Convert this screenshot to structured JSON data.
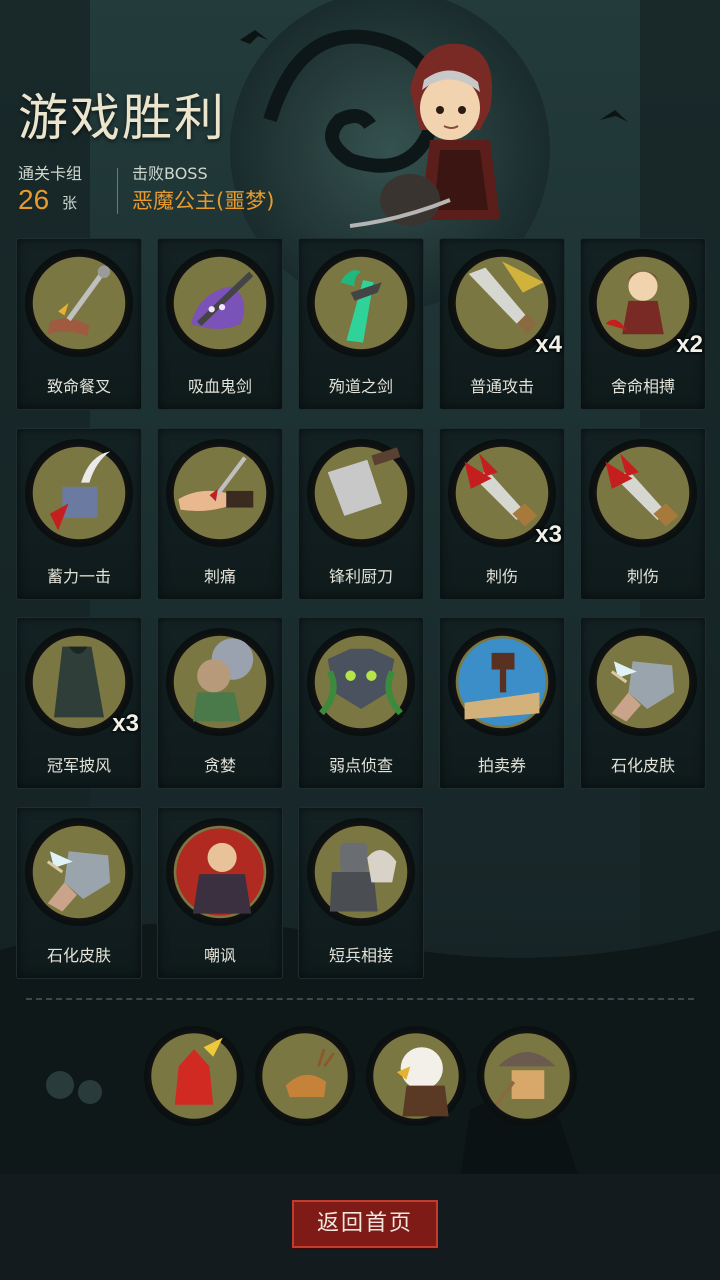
{
  "header": {
    "title": "游戏胜利",
    "deck_label": "通关卡组",
    "deck_count": "26",
    "deck_unit": "张",
    "boss_label": "击败BOSS",
    "boss_name": "恶魔公主(噩梦)"
  },
  "cards": [
    {
      "name": "致命餐叉",
      "qty": "",
      "icon": "fork-icon"
    },
    {
      "name": "吸血鬼剑",
      "qty": "",
      "icon": "vampire-sword-icon"
    },
    {
      "name": "殉道之剑",
      "qty": "",
      "icon": "martyr-sword-icon"
    },
    {
      "name": "普通攻击",
      "qty": "x4",
      "icon": "sword-icon"
    },
    {
      "name": "舍命相搏",
      "qty": "x2",
      "icon": "red-hood-fighter-icon"
    },
    {
      "name": "蓄力一击",
      "qty": "",
      "icon": "hammer-strike-icon"
    },
    {
      "name": "刺痛",
      "qty": "",
      "icon": "stabbed-hand-icon"
    },
    {
      "name": "锋利厨刀",
      "qty": "",
      "icon": "cleaver-icon"
    },
    {
      "name": "刺伤",
      "qty": "x3",
      "icon": "dagger-icon"
    },
    {
      "name": "刺伤",
      "qty": "",
      "icon": "dagger-icon"
    },
    {
      "name": "冠军披风",
      "qty": "x3",
      "icon": "cloak-icon"
    },
    {
      "name": "贪婪",
      "qty": "",
      "icon": "goblin-icon"
    },
    {
      "name": "弱点侦查",
      "qty": "",
      "icon": "wolf-icon"
    },
    {
      "name": "拍卖券",
      "qty": "",
      "icon": "gavel-icon"
    },
    {
      "name": "石化皮肤",
      "qty": "",
      "icon": "stone-fist-icon"
    },
    {
      "name": "石化皮肤",
      "qty": "",
      "icon": "stone-fist-icon"
    },
    {
      "name": "嘲讽",
      "qty": "",
      "icon": "taunt-icon"
    },
    {
      "name": "短兵相接",
      "qty": "",
      "icon": "knight-icon"
    }
  ],
  "relics": [
    {
      "icon": "red-imp-icon"
    },
    {
      "icon": "deer-icon"
    },
    {
      "icon": "eagle-icon"
    },
    {
      "icon": "helmet-creature-icon"
    }
  ],
  "footer": {
    "back_label": "返回首页"
  },
  "colors": {
    "accent": "#e79a2d",
    "medal_fill": "#7b7742",
    "button": "#7e1b16"
  }
}
